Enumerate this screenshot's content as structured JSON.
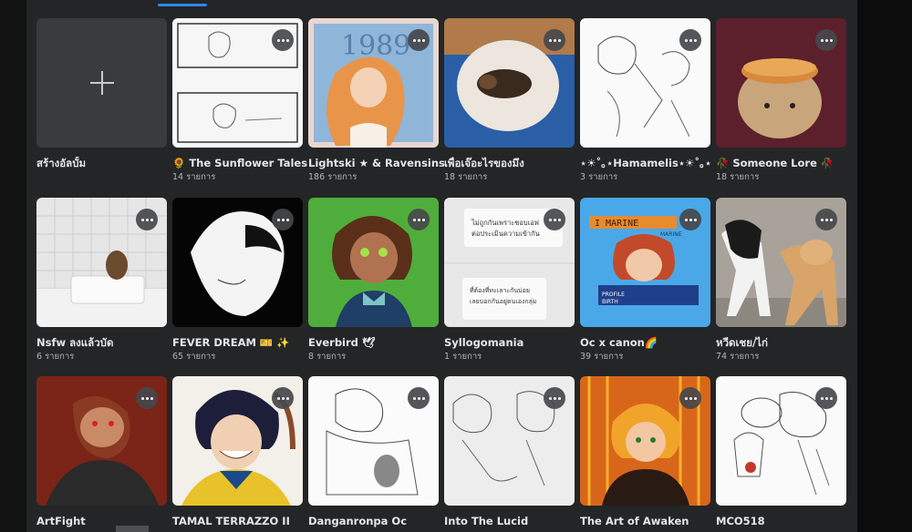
{
  "create_album": {
    "label": "สร้างอัลบั้ม"
  },
  "albums": [
    {
      "title": "🌻 The Sunflower Tales🌻",
      "count": "14 รายการ"
    },
    {
      "title": "Lightski ★ & Ravensins 🕊",
      "count": "186 รายการ"
    },
    {
      "title": "เพื่อเจ๊อะไรของมึง",
      "count": "18 รายการ"
    },
    {
      "title": "⋆☀︎˚｡⋆Hamamelis⋆☀︎˚｡⋆",
      "count": "3 รายการ"
    },
    {
      "title": "🥀 Someone Lore 🥀",
      "count": "18 รายการ"
    },
    {
      "title": "Nsfw ลงแล้วบัด",
      "count": "6 รายการ"
    },
    {
      "title": "FEVER DREAM 🎫 ✨",
      "count": "65 รายการ"
    },
    {
      "title": "Everbird 🕊",
      "count": "8 รายการ"
    },
    {
      "title": "Syllogomania",
      "count": "1 รายการ"
    },
    {
      "title": "Oc x canon🌈",
      "count": "39 รายการ"
    },
    {
      "title": "หวีดเชย/ไก่",
      "count": "74 รายการ"
    },
    {
      "title": "ArtFight",
      "count": ""
    },
    {
      "title": "TAMAL TERRAZZO II",
      "count": ""
    },
    {
      "title": "Danganronpa Oc",
      "count": ""
    },
    {
      "title": "Into The Lucid",
      "count": ""
    },
    {
      "title": "The Art of Awaken",
      "count": ""
    },
    {
      "title": "MCO518",
      "count": ""
    }
  ],
  "thumb_texts": {
    "album_1989": "1989",
    "syllo_note1": "ไม่ถูกกันเพราะชอบเอฟ",
    "syllo_note2": "ต่อประเมินความเข้ากัน",
    "syllo_note3": "ที่ต้องที่ทะเลาะกันบ่อย",
    "syllo_note4": "เลยบอกกันอยู่ตนเองกลุ่ม",
    "oc_banner": "I MARINE",
    "oc_tag": "MARINE",
    "oc_name": "PROFILE",
    "oc_birth": "BIRTH"
  },
  "icons": {
    "more": "more-options-icon",
    "add": "plus-icon"
  },
  "colors": {
    "panel": "#242526",
    "tile": "#3a3b3c",
    "accent": "#2d88ff",
    "text": "#e4e6eb",
    "subtext": "#b0b3b8"
  }
}
